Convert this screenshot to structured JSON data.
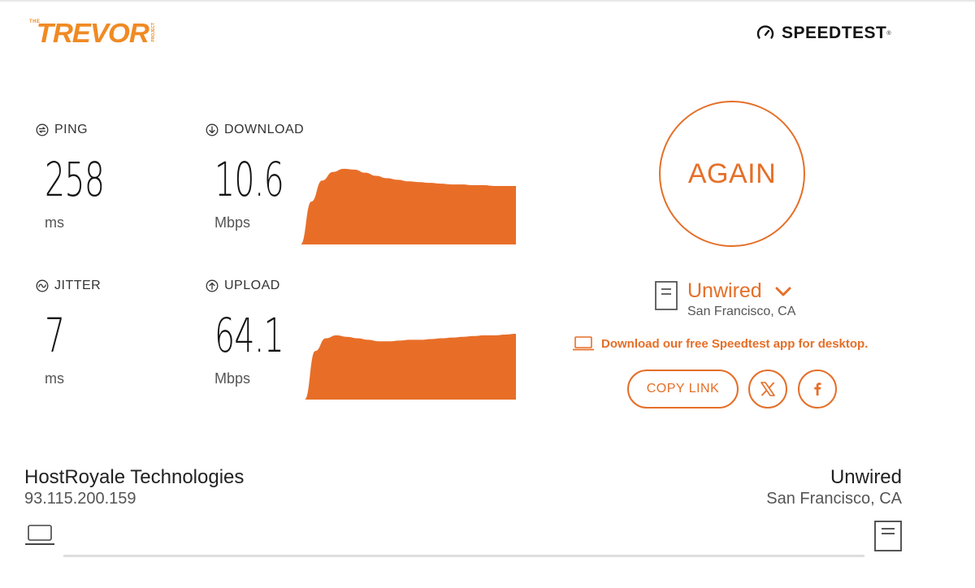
{
  "brand": {
    "logo_small": "THE",
    "logo_word": "TREVOR",
    "logo_sub": "PROJECT",
    "speedtest_label": "SPEEDTEST",
    "trademark": "®"
  },
  "metrics": {
    "ping": {
      "label": "PING",
      "value": "258",
      "unit": "ms",
      "icon": "ping-icon"
    },
    "jitter": {
      "label": "JITTER",
      "value": "7",
      "unit": "ms",
      "icon": "jitter-icon"
    },
    "download": {
      "label": "DOWNLOAD",
      "value": "10.6",
      "unit": "Mbps",
      "icon": "download-arrow-icon"
    },
    "upload": {
      "label": "UPLOAD",
      "value": "64.1",
      "unit": "Mbps",
      "icon": "upload-arrow-icon"
    }
  },
  "chart_data": [
    {
      "type": "area",
      "name": "download-throughput",
      "x": [
        0,
        1,
        2,
        3,
        4,
        5,
        6,
        7,
        8,
        9,
        10,
        11,
        12,
        13,
        14,
        15,
        16,
        17,
        18,
        19,
        20
      ],
      "values": [
        0.0,
        0.55,
        0.82,
        0.93,
        0.97,
        0.96,
        0.92,
        0.88,
        0.85,
        0.83,
        0.81,
        0.8,
        0.79,
        0.78,
        0.77,
        0.77,
        0.76,
        0.76,
        0.75,
        0.75,
        0.75
      ],
      "color": "#e86e28"
    },
    {
      "type": "area",
      "name": "upload-throughput",
      "x": [
        0,
        1,
        2,
        3,
        4,
        5,
        6,
        7,
        8,
        9,
        10,
        11,
        12,
        13,
        14,
        15,
        16,
        17,
        18,
        19,
        20
      ],
      "values": [
        0.0,
        0.65,
        0.82,
        0.86,
        0.84,
        0.82,
        0.8,
        0.78,
        0.78,
        0.79,
        0.8,
        0.8,
        0.81,
        0.82,
        0.83,
        0.84,
        0.85,
        0.86,
        0.86,
        0.87,
        0.88
      ],
      "color": "#e86e28"
    }
  ],
  "actions": {
    "again_label": "AGAIN",
    "copy_link_label": "COPY LINK"
  },
  "server": {
    "name": "Unwired",
    "location": "San Francisco, CA"
  },
  "promo": {
    "text": "Download our free Speedtest app for desktop."
  },
  "connection": {
    "host_name": "HostRoyale Technologies",
    "host_ip": "93.115.200.159",
    "server_name": "Unwired",
    "server_location": "San Francisco, CA"
  },
  "colors": {
    "accent": "#e56f28",
    "text_dark": "#141414",
    "text_muted": "#555555"
  }
}
